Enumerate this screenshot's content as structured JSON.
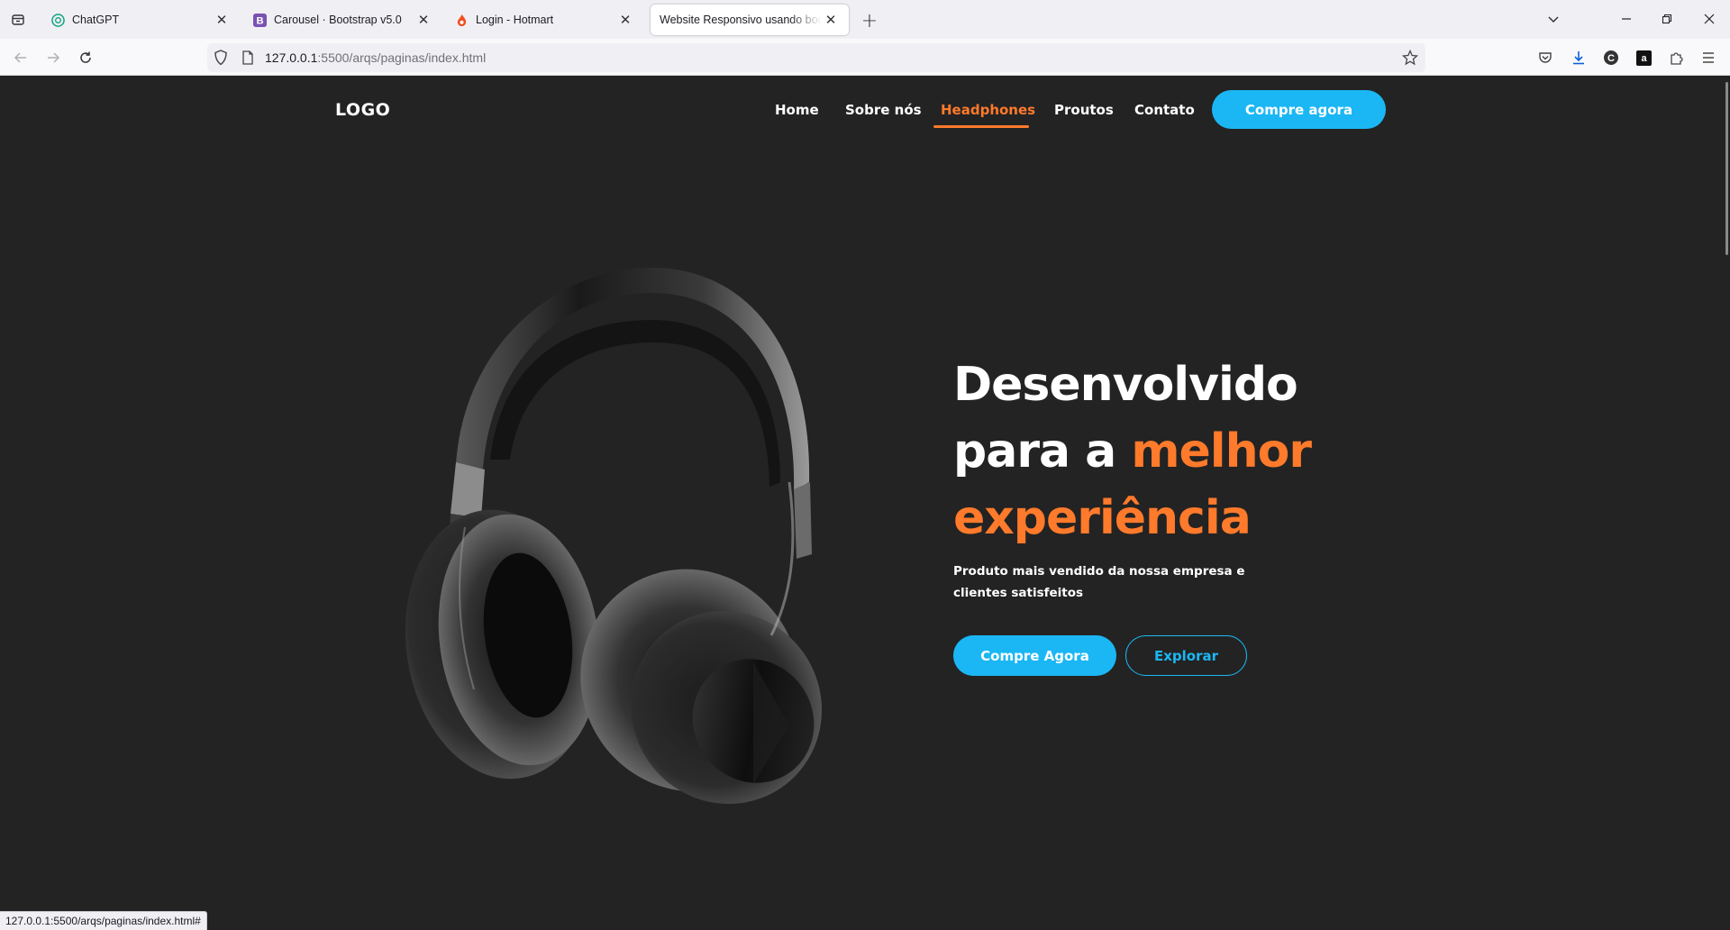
{
  "browser": {
    "tabs": [
      {
        "title": "ChatGPT",
        "icon": "chatgpt-icon"
      },
      {
        "title": "Carousel · Bootstrap v5.0",
        "icon": "bootstrap-icon"
      },
      {
        "title": "Login - Hotmart",
        "icon": "hotmart-icon"
      },
      {
        "title": "Website Responsivo usando bootstrap",
        "icon": "none"
      }
    ],
    "url_host": "127.0.0.1",
    "url_path": ":5500/arqs/paginas/index.html",
    "status_url": "127.0.0.1:5500/arqs/paginas/index.html#"
  },
  "site": {
    "logo": "LOGO",
    "nav": {
      "home": "Home",
      "sobre": "Sobre nós",
      "headphones": "Headphones",
      "produtos": "Proutos",
      "contato": "Contato",
      "active": "Headphones"
    },
    "cta_nav": "Compre agora",
    "hero": {
      "line1": "Desenvolvido",
      "line2a": "para a ",
      "line2b": "melhor",
      "line3": "experiência",
      "subtitle": "Produto mais vendido da nossa empresa e clientes satisfeitos",
      "btn_primary": "Compre Agora",
      "btn_secondary": "Explorar"
    }
  },
  "colors": {
    "accent_orange": "#ff7a2b",
    "accent_blue": "#1bb7f4",
    "background": "#232323"
  }
}
